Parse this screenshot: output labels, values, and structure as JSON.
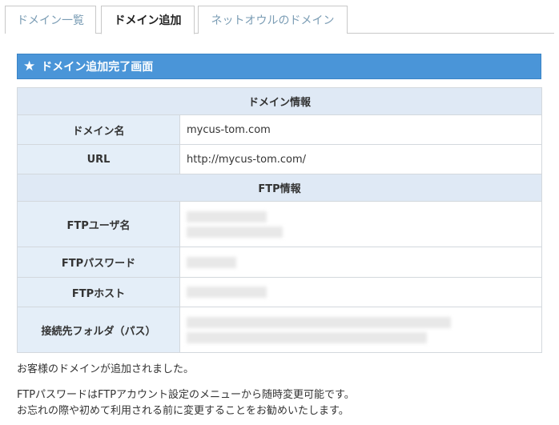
{
  "tabs": [
    {
      "label": "ドメイン一覧"
    },
    {
      "label": "ドメイン追加"
    },
    {
      "label": "ネットオウルのドメイン"
    }
  ],
  "panel": {
    "title": "ドメイン追加完了画面",
    "icon": "star-icon",
    "accent": "#4a95d8"
  },
  "domain_info": {
    "heading": "ドメイン情報",
    "rows": [
      {
        "label": "ドメイン名",
        "value": "mycus-tom.com"
      },
      {
        "label": "URL",
        "value": "http://mycus-tom.com/"
      }
    ]
  },
  "ftp_info": {
    "heading": "FTP情報",
    "rows": [
      {
        "label": "FTPユーザ名"
      },
      {
        "label": "FTPパスワード"
      },
      {
        "label": "FTPホスト"
      },
      {
        "label": "接続先フォルダ（パス）"
      }
    ]
  },
  "messages": {
    "line1": "お客様のドメインが追加されました。",
    "line2": "FTPパスワードはFTPアカウント設定のメニューから随時変更可能です。",
    "line3": "お忘れの際や初めて利用される前に変更することをお勧めいたします。"
  }
}
